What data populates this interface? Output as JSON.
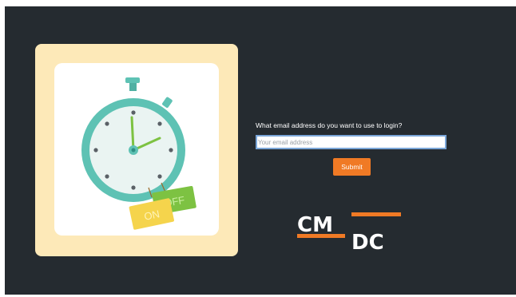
{
  "login": {
    "question": "What email address do you want to use to login?",
    "email_placeholder": "Your email address",
    "email_value": "",
    "submit_label": "Submit"
  },
  "illustration": {
    "sign_on_text": "ON",
    "sign_off_text": "OFF"
  },
  "logo": {
    "text_top": "CM",
    "text_bottom": "DC",
    "accent_color": "#f07a25"
  },
  "colors": {
    "background": "#252b30",
    "accent": "#f07a25",
    "card": "#fde9b8",
    "clock_teal": "#5ec2b4"
  }
}
